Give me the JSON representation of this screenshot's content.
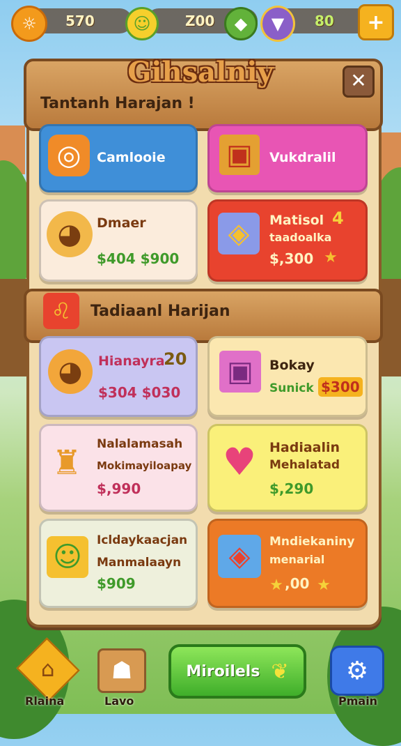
{
  "resources": [
    {
      "icon": "sun-icon",
      "value": "570"
    },
    {
      "icon": "gold-coin-icon",
      "value": "Z00"
    },
    {
      "icon": "green-gem-icon",
      "value": ""
    },
    {
      "icon": "purple-potion-icon",
      "value": "80"
    }
  ],
  "header": {
    "title": "Gihsalniy",
    "subtitle": "Tantanh Harajan !",
    "close_label": "✕"
  },
  "section": {
    "title": "Tadiaanl Harijan"
  },
  "cards_top": [
    {
      "title": "Camlooie",
      "price": "",
      "color": "#3f8fd8"
    },
    {
      "title": "Vukdralil",
      "price": "",
      "color": "#e855b4"
    },
    {
      "title": "Dmaer",
      "price": "$404 $900",
      "color": "#fbecdc"
    },
    {
      "title": "Matisol",
      "badge": "4",
      "subtitle": "taadoalka",
      "price": "$,300",
      "color": "#e8432e"
    }
  ],
  "cards_bottom": [
    {
      "title": "Hianayra",
      "badge": "20",
      "price": "$304 $030",
      "color": "#c9c6f2"
    },
    {
      "title": "Bokay",
      "subtitle": "Sunick",
      "price": "$300",
      "color": "#fbe7b0"
    },
    {
      "title": "Nalalamasah",
      "subtitle": "Mokimayiloapay",
      "price": "$,990",
      "color": "#fbe2e8"
    },
    {
      "title": "Hadiaalin",
      "subtitle": "Mehalatad",
      "price": "$,290",
      "color": "#faf07a"
    },
    {
      "title": "Icldaykaacjan",
      "subtitle": "Manmalaayn",
      "price": "$909",
      "color": "#eef0dc"
    },
    {
      "title": "Mndiekaniny",
      "subtitle": "menarial",
      "price": ",00",
      "color": "#ec7a26"
    }
  ],
  "bottom_nav": {
    "left_label": "Rlaina",
    "second_label": "Lavo",
    "center_button": "Miroilels",
    "right_label": "Pmain"
  },
  "colors": {
    "panel": "#f2dcae",
    "wood": "#b97a3c",
    "price_green": "#3f9a2a",
    "accent_gold": "#f5b21f"
  }
}
